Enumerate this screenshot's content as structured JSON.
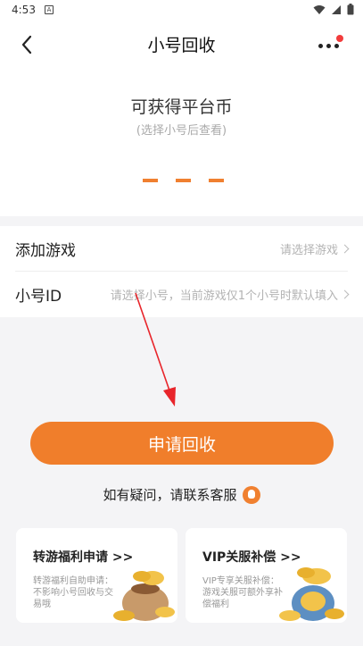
{
  "status": {
    "time": "4:53",
    "app_icon": "A"
  },
  "header": {
    "title": "小号回收"
  },
  "reward": {
    "title": "可获得平台币",
    "subtitle": "(选择小号后查看)"
  },
  "form": {
    "game": {
      "label": "添加游戏",
      "placeholder": "请选择游戏"
    },
    "account": {
      "label": "小号ID",
      "placeholder": "请选择小号，当前游戏仅1个小号时默认填入"
    }
  },
  "actions": {
    "apply_label": "申请回收"
  },
  "contact": {
    "text": "如有疑问，请联系客服"
  },
  "cards": [
    {
      "title": "转游福利申请 >>",
      "desc": "转游福利自助申请：不影响小号回收与交易哦"
    },
    {
      "title": "VIP关服补偿 >>",
      "desc": "VIP专享关服补偿：游戏关服可额外享补偿福利"
    }
  ],
  "colors": {
    "accent": "#f07e2b",
    "background": "#f4f4f6",
    "notification": "#f23c3c"
  }
}
